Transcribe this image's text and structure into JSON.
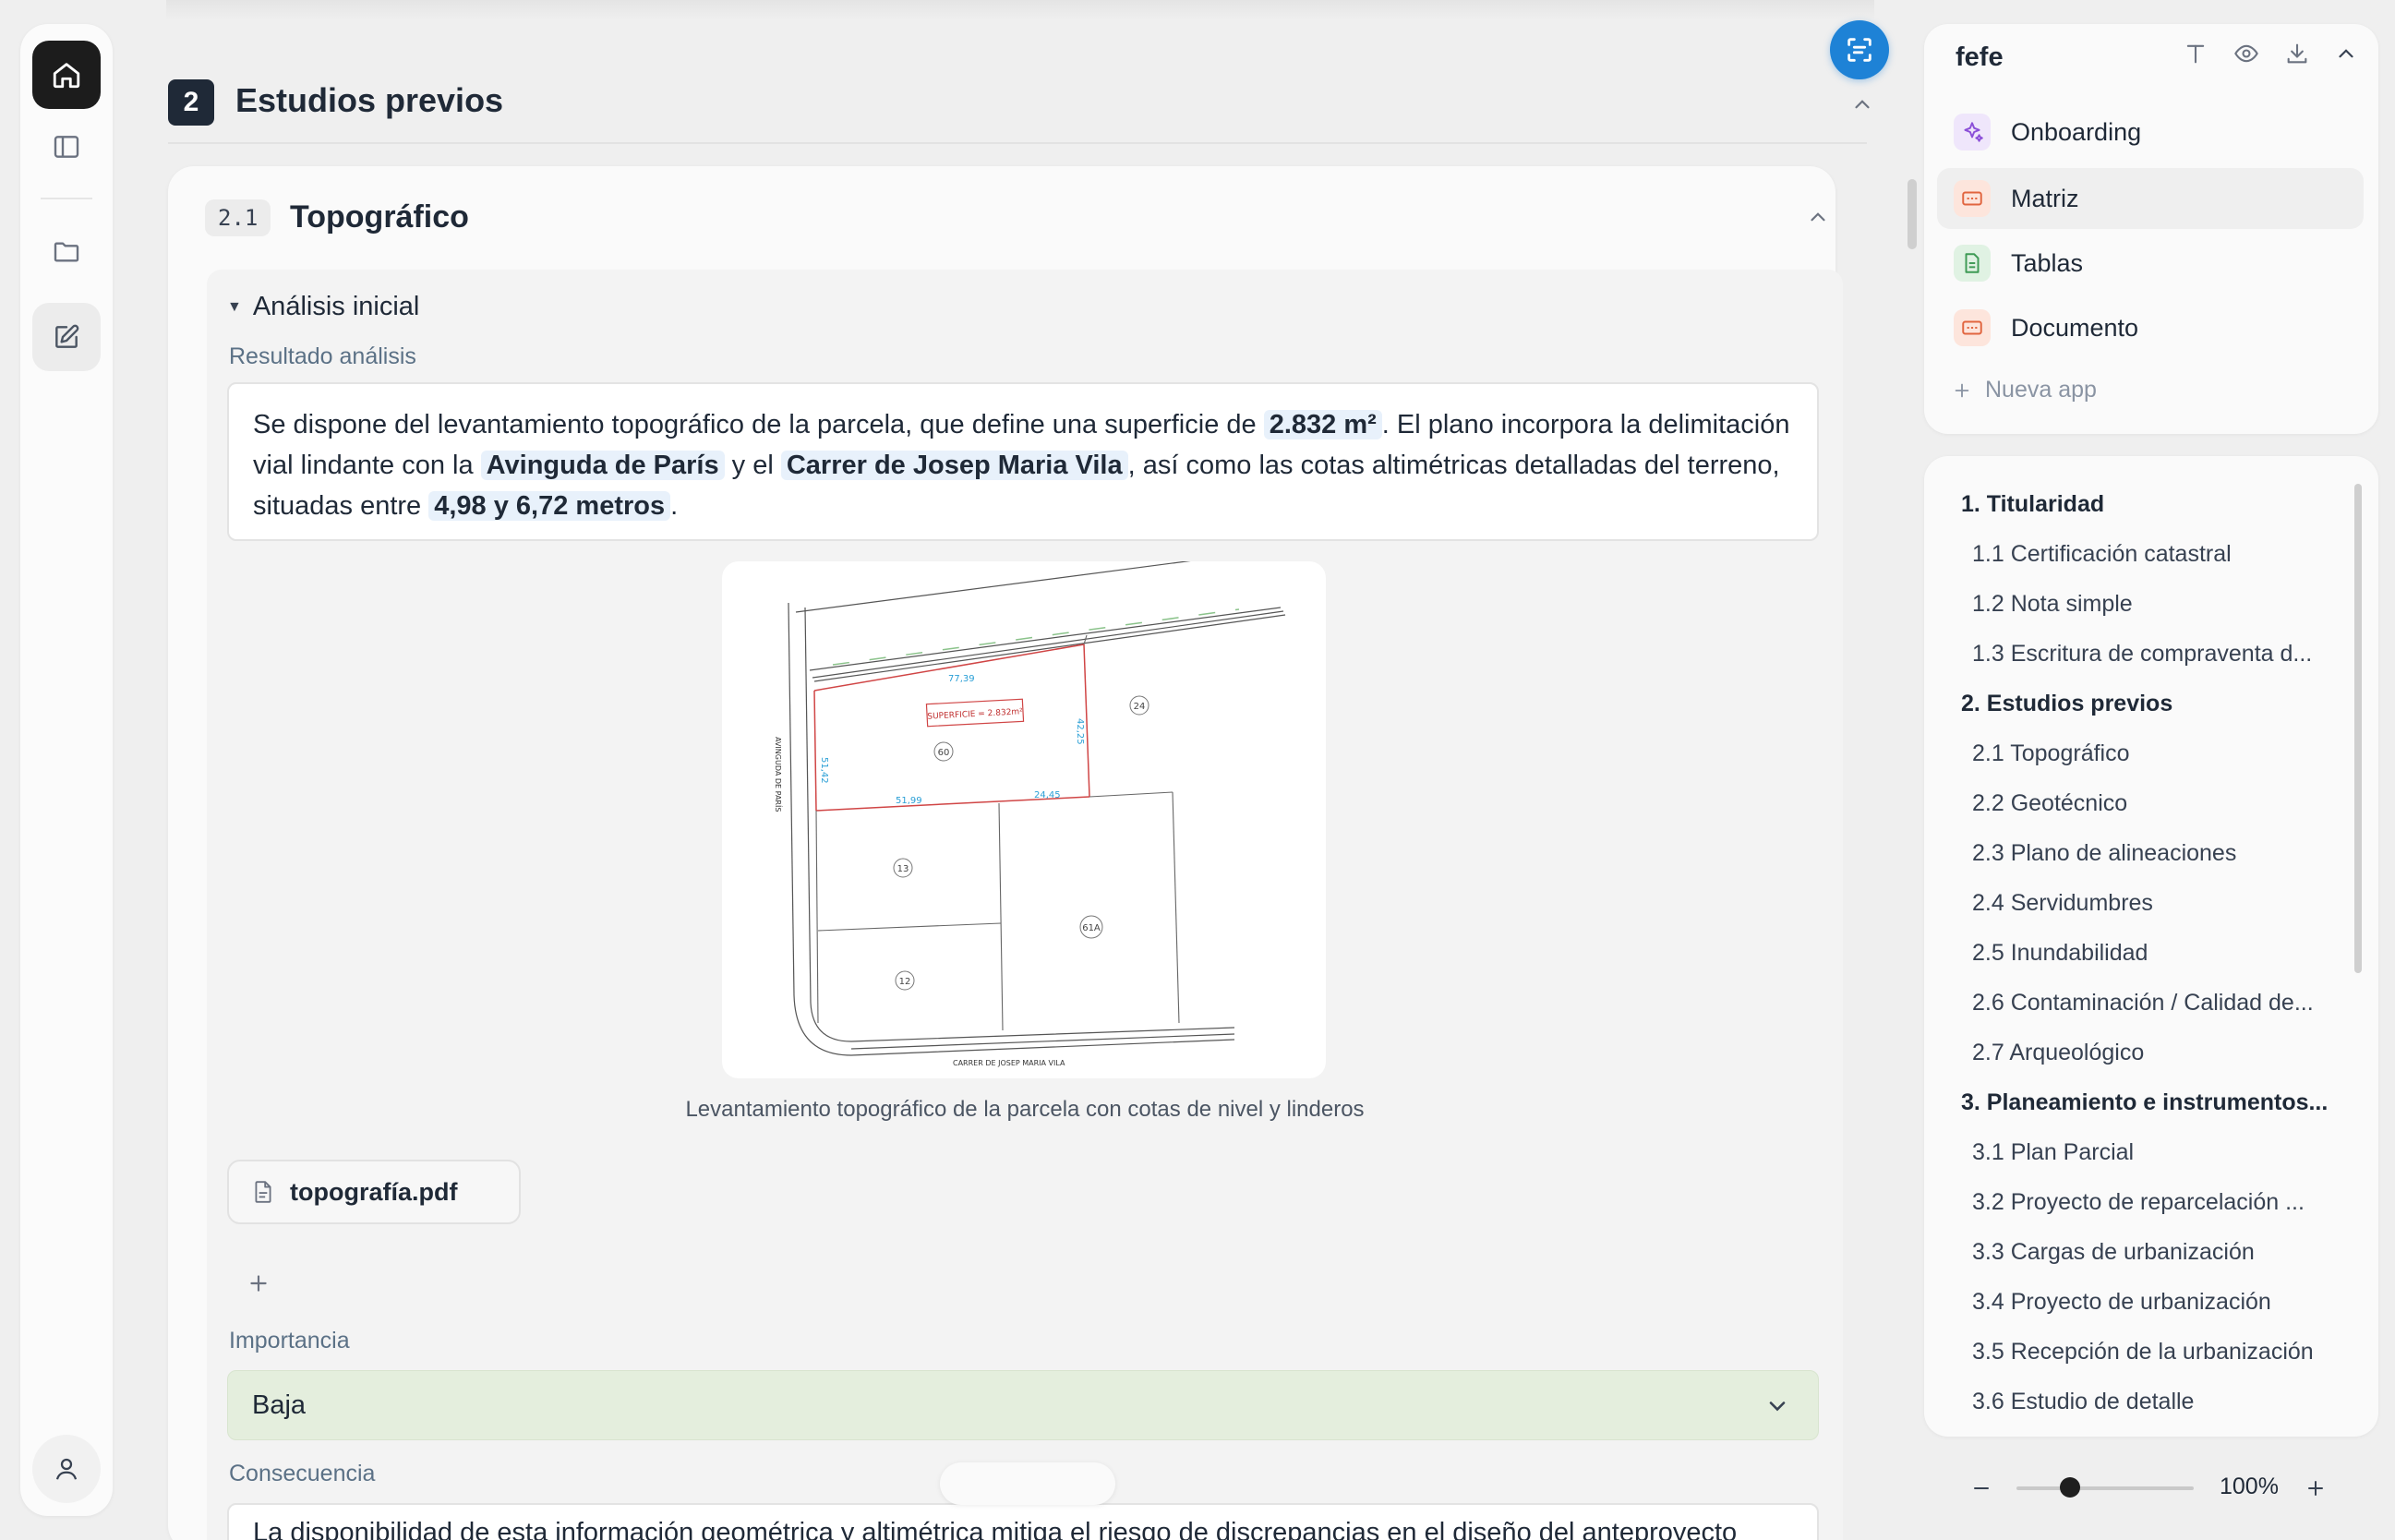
{
  "section": {
    "number": "2",
    "title": "Estudios previos"
  },
  "subsection": {
    "number": "2.1",
    "title": "Topográfico"
  },
  "analysis": {
    "toggle_label": "Análisis inicial",
    "result_label": "Resultado análisis",
    "text": {
      "p1": "Se dispone del levantamiento topográfico de la parcela, que define una superficie de ",
      "h1": "2.832 m²",
      "p2": ". El plano incorpora la delimitación vial lindante con la ",
      "h2": "Avinguda de París",
      "p3": " y el ",
      "h3": "Carrer de Josep Maria Vila",
      "p4": ", así como las cotas altimétricas detalladas del terreno, situadas entre ",
      "h4": "4,98 y 6,72 metros",
      "p5": "."
    }
  },
  "plan": {
    "surface_label": "SUPERFICIE = 2.832m²",
    "street_left": "AVINGUDA DE PARÍS",
    "street_bottom": "CARRER DE JOSEP MARIA VILA",
    "dims": [
      "77,39",
      "51,42",
      "42,25",
      "51,99",
      "24,45"
    ],
    "parcels": [
      "60",
      "24",
      "13",
      "12",
      "61A"
    ],
    "caption": "Levantamiento topográfico de la parcela con cotas de nivel y linderos"
  },
  "attachment": {
    "filename": "topografía.pdf"
  },
  "importance": {
    "label": "Importancia",
    "value": "Baja"
  },
  "consequence": {
    "label": "Consecuencia",
    "text": "La disponibilidad de esta información geométrica y altimétrica mitiga el riesgo de discrepancias en el diseño del anteproyecto"
  },
  "apps": {
    "title": "fefe",
    "items": [
      {
        "label": "Onboarding",
        "icon": "sparkles-icon"
      },
      {
        "label": "Matriz",
        "icon": "grid-icon"
      },
      {
        "label": "Tablas",
        "icon": "sheet-icon"
      },
      {
        "label": "Documento",
        "icon": "doc-icon"
      }
    ],
    "new_app": "Nueva app"
  },
  "toc": {
    "items": [
      {
        "label": "1. Titularidad",
        "level": 1
      },
      {
        "label": "1.1 Certificación catastral",
        "level": 2
      },
      {
        "label": "1.2 Nota simple",
        "level": 2
      },
      {
        "label": "1.3 Escritura de compraventa d...",
        "level": 2
      },
      {
        "label": "2. Estudios previos",
        "level": 1
      },
      {
        "label": "2.1 Topográfico",
        "level": 2
      },
      {
        "label": "2.2 Geotécnico",
        "level": 2
      },
      {
        "label": "2.3 Plano de alineaciones",
        "level": 2
      },
      {
        "label": "2.4 Servidumbres",
        "level": 2
      },
      {
        "label": "2.5 Inundabilidad",
        "level": 2
      },
      {
        "label": "2.6 Contaminación / Calidad de...",
        "level": 2
      },
      {
        "label": "2.7 Arqueológico",
        "level": 2
      },
      {
        "label": "3. Planeamiento e instrumentos...",
        "level": 1
      },
      {
        "label": "3.1 Plan Parcial",
        "level": 2
      },
      {
        "label": "3.2 Proyecto de reparcelación ...",
        "level": 2
      },
      {
        "label": "3.3 Cargas de urbanización",
        "level": 2
      },
      {
        "label": "3.4 Proyecto de urbanización",
        "level": 2
      },
      {
        "label": "3.5 Recepción de la urbanización",
        "level": 2
      },
      {
        "label": "3.6 Estudio de detalle",
        "level": 2
      }
    ]
  },
  "zoom": {
    "value": "100%",
    "level": 0.3
  },
  "colors": {
    "accent": "#1e82d6",
    "dark": "#1f2937",
    "importance_bg": "#e4eedd",
    "highlight": "#e8f1fb"
  }
}
